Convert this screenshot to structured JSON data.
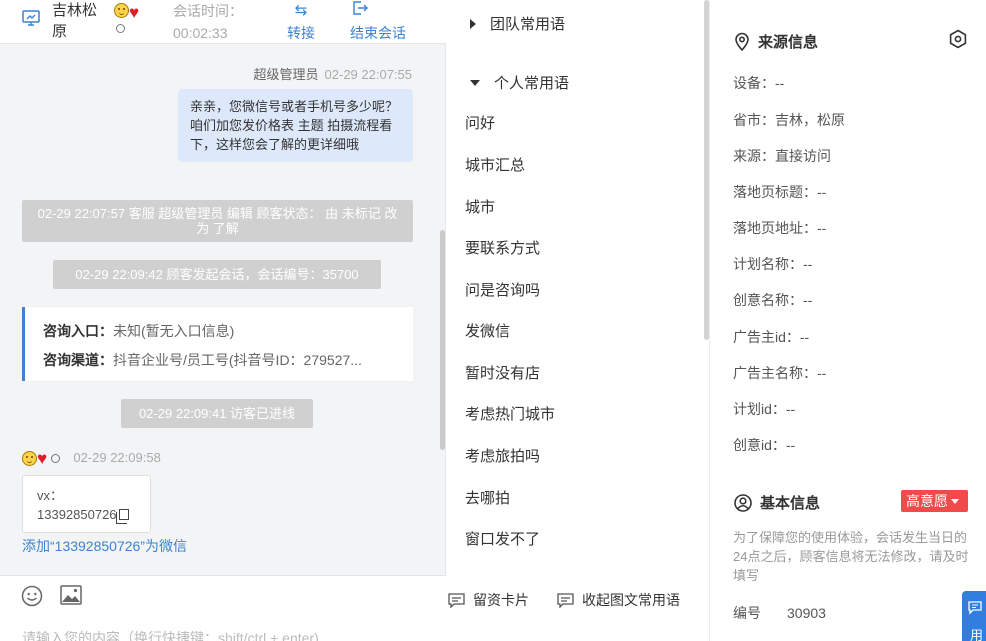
{
  "header": {
    "visitor_location": "吉林松原",
    "session_time_label": "会话时间：",
    "session_time": "00:02:33",
    "transfer_label": "转接",
    "end_label": "结束会话"
  },
  "chat": {
    "agent_name": "超级管理员",
    "agent_time": "02-29 22:07:55",
    "agent_message": "亲亲，您微信号或者手机号多少呢？咱们加您发价格表 主题 拍摄流程看下，这样您会了解的更详细哦",
    "sys_status_change": "02-29 22:07:57 客服 超级管理员 编辑 顾客状态： 由 未标记 改为 了解",
    "sys_session_start": "02-29 22:09:42 顾客发起会话，会话编号：35700",
    "entry_label": "咨询入口：",
    "entry_value": "未知(暂无入口信息)",
    "channel_label": "咨询渠道：",
    "channel_value": "抖音企业号/员工号(抖音号ID：279527...",
    "sys_visitor_entered": "02-29 22:09:41 访客已进线",
    "visitor_time": "02-29 22:09:58",
    "visitor_msg_prefix": "vx：",
    "visitor_msg_number": "13392850726",
    "add_wechat_link": "添加“13392850726”为微信",
    "input_placeholder": "请输入您的内容（换行快捷键：shift/ctrl + enter)"
  },
  "phrases": {
    "team_group": "团队常用语",
    "personal_group": "个人常用语",
    "items": [
      "问好",
      "城市汇总",
      "城市",
      "要联系方式",
      "问是咨询吗",
      "发微信",
      "暂时没有店",
      "考虑热门城市",
      "考虑旅拍吗",
      "去哪拍",
      "窗口发不了"
    ],
    "lead_card_label": "留资卡片",
    "image_text_label": "收起图文常用语"
  },
  "profile": {
    "source_title": "来源信息",
    "source_fields": [
      "设备：--",
      "省市：吉林，松原",
      "来源：直接访问",
      "落地页标题：--",
      "落地页地址：--",
      "计划名称：--",
      "创意名称：--",
      "广告主id：--",
      "广告主名称：--",
      "计划id：--",
      "创意id：--"
    ],
    "basic_title": "基本信息",
    "intent_badge": "高意愿",
    "notice": "为了保障您的使用体验，会话发生当日的24点之后，顾客信息将无法修改，请及时填写",
    "serial_label": "编号",
    "serial_value": "30903",
    "float_label": "用"
  },
  "colors": {
    "accent": "#3b82d6",
    "agent_bubble": "#dde9fb",
    "system_note": "#d0d0d0",
    "intent_badge": "#f04a4a",
    "float_button": "#2f7ee0"
  },
  "icons": [
    "monitor-icon",
    "transfer-icon",
    "logout-icon",
    "emoji-icon",
    "image-icon",
    "message-card-icon",
    "location-pin-icon",
    "settings-hex-icon",
    "user-circle-icon",
    "chat-float-icon"
  ]
}
